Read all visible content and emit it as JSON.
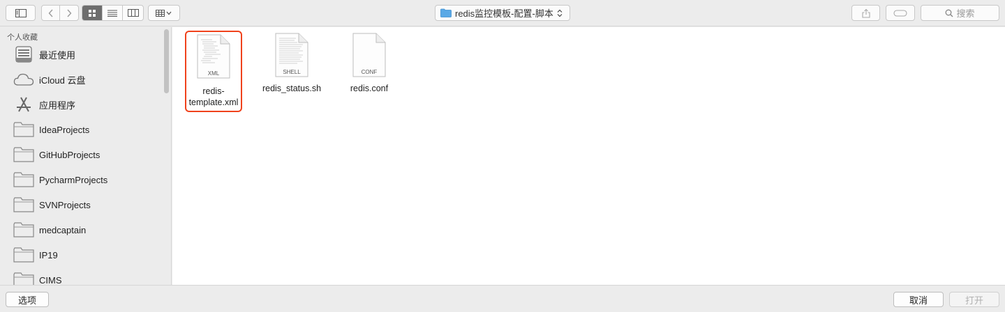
{
  "toolbar": {
    "path_label": "redis监控模板-配置-脚本",
    "path_arrows": "⌃⌄",
    "search_placeholder": "搜索"
  },
  "sidebar": {
    "header": "个人收藏",
    "items": [
      {
        "label": "最近使用",
        "icon": "recents-icon"
      },
      {
        "label": "iCloud 云盘",
        "icon": "icloud-icon"
      },
      {
        "label": "应用程序",
        "icon": "applications-icon"
      },
      {
        "label": "IdeaProjects",
        "icon": "folder-icon"
      },
      {
        "label": "GitHubProjects",
        "icon": "folder-icon"
      },
      {
        "label": "PycharmProjects",
        "icon": "folder-icon"
      },
      {
        "label": "SVNProjects",
        "icon": "folder-icon"
      },
      {
        "label": "medcaptain",
        "icon": "folder-icon"
      },
      {
        "label": "IP19",
        "icon": "folder-icon"
      },
      {
        "label": "CIMS",
        "icon": "folder-icon"
      }
    ]
  },
  "files": [
    {
      "name": "redis-\ntemplate.xml",
      "ext": "XML",
      "selected": true
    },
    {
      "name": "redis_status.sh",
      "ext": "SHELL",
      "selected": false
    },
    {
      "name": "redis.conf",
      "ext": "CONF",
      "selected": false
    }
  ],
  "bottom": {
    "options_label": "选项",
    "cancel_label": "取消",
    "open_label": "打开"
  },
  "colors": {
    "selection_border": "#f0421c",
    "active_segment": "#6d6d6d",
    "folder_blue": "#5aa9e6"
  }
}
